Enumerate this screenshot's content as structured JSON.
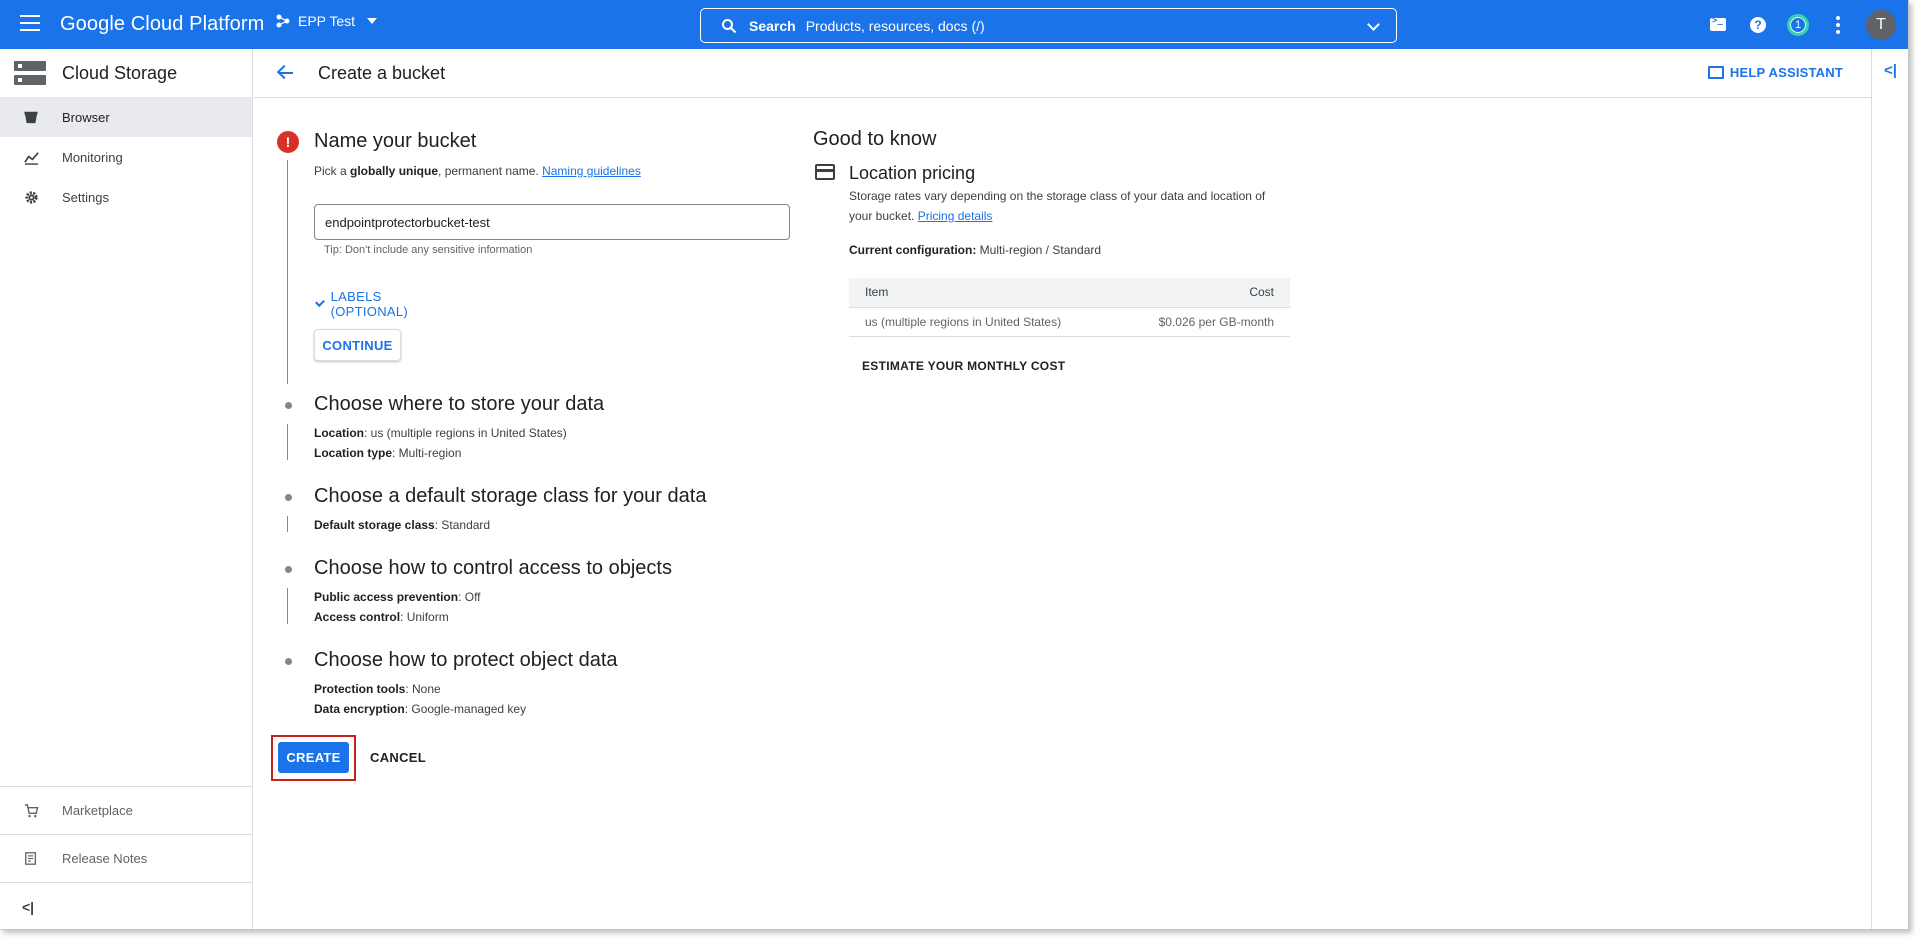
{
  "topbar": {
    "brand": "Google Cloud Platform",
    "project": "EPP Test",
    "search_label": "Search",
    "search_placeholder": "Products, resources, docs (/)",
    "notification_count": "1",
    "avatar_initial": "T",
    "accent_color": "#1a73e8"
  },
  "sidebar": {
    "title": "Cloud Storage",
    "items": [
      {
        "label": "Browser",
        "icon": "bucket-icon",
        "active": true
      },
      {
        "label": "Monitoring",
        "icon": "chart-icon",
        "active": false
      },
      {
        "label": "Settings",
        "icon": "gear-icon",
        "active": false
      }
    ],
    "bottom_items": [
      {
        "label": "Marketplace",
        "icon": "cart-icon"
      },
      {
        "label": "Release Notes",
        "icon": "notes-icon"
      }
    ],
    "collapse_glyph": "<|"
  },
  "page": {
    "title": "Create a bucket",
    "help_assistant": "HELP ASSISTANT",
    "rail_glyph": "<|"
  },
  "steps": {
    "name": {
      "title": "Name your bucket",
      "desc_prefix": "Pick a ",
      "desc_bold": "globally unique",
      "desc_suffix": ", permanent name. ",
      "desc_link": "Naming guidelines",
      "input_value": "endpointprotectorbucket-test",
      "tip": "Tip: Don't include any sensitive information",
      "labels_toggle": "LABELS (OPTIONAL)",
      "continue": "CONTINUE"
    },
    "location": {
      "title": "Choose where to store your data",
      "line1_label": "Location",
      "line1_value": ": us (multiple regions in United States)",
      "line2_label": "Location type",
      "line2_value": ": Multi-region"
    },
    "storage_class": {
      "title": "Choose a default storage class for your data",
      "line1_label": "Default storage class",
      "line1_value": ": Standard"
    },
    "access": {
      "title": "Choose how to control access to objects",
      "line1_label": "Public access prevention",
      "line1_value": ": Off",
      "line2_label": "Access control",
      "line2_value": ": Uniform"
    },
    "protect": {
      "title": "Choose how to protect object data",
      "line1_label": "Protection tools",
      "line1_value": ": None",
      "line2_label": "Data encryption",
      "line2_value": ": Google-managed key"
    }
  },
  "actions": {
    "create": "CREATE",
    "cancel": "CANCEL"
  },
  "good_to_know": {
    "title": "Good to know",
    "pricing_title": "Location pricing",
    "pricing_desc": "Storage rates vary depending on the storage class of your data and location of your bucket. ",
    "pricing_link": "Pricing details",
    "config_label": "Current configuration:",
    "config_value": " Multi-region / Standard",
    "table": {
      "headers": [
        "Item",
        "Cost"
      ],
      "rows": [
        [
          "us (multiple regions in United States)",
          "$0.026 per GB-month"
        ]
      ]
    },
    "estimate": "ESTIMATE YOUR MONTHLY COST"
  }
}
